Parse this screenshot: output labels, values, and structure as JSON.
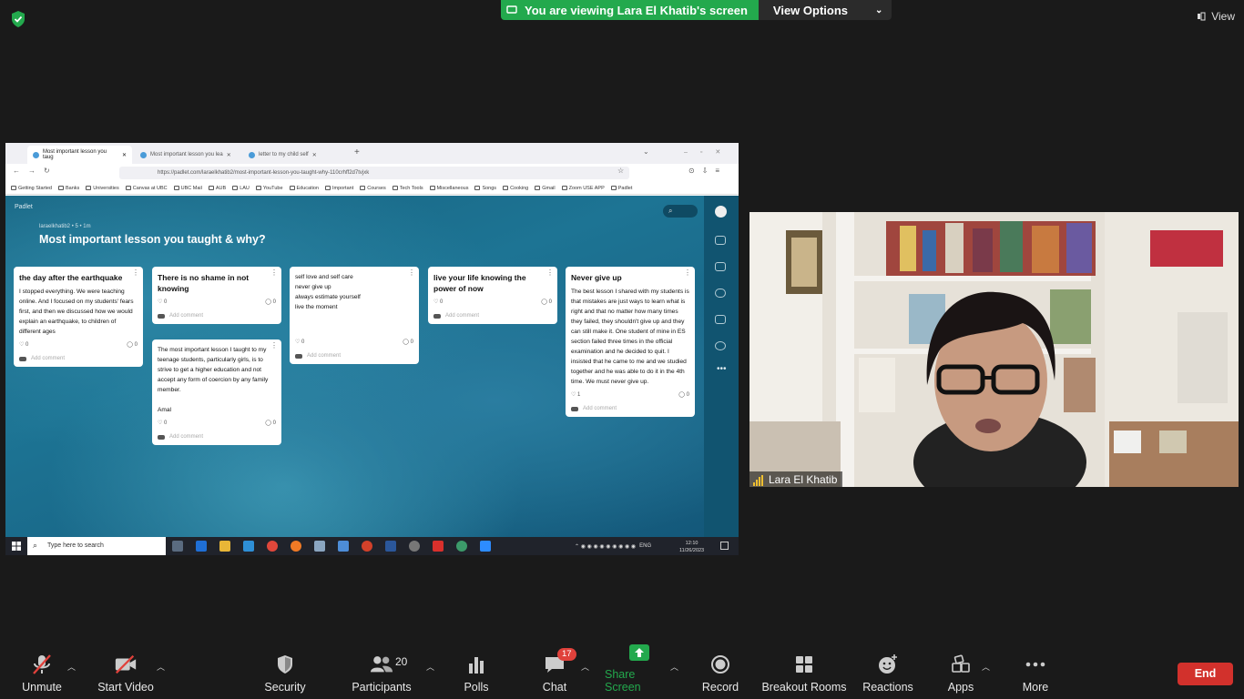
{
  "zoom": {
    "banner_text": "You are viewing Lara El Khatib's screen",
    "view_options": "View Options",
    "view_label": "View",
    "participant_name": "Lara El Khatib",
    "toolbar": {
      "unmute": "Unmute",
      "start_video": "Start Video",
      "security": "Security",
      "participants": "Participants",
      "participants_count": "20",
      "polls": "Polls",
      "chat": "Chat",
      "chat_badge": "17",
      "share_screen": "Share Screen",
      "record": "Record",
      "breakout_rooms": "Breakout Rooms",
      "reactions": "Reactions",
      "apps": "Apps",
      "more": "More",
      "end": "End"
    },
    "colors": {
      "green": "#23a94d",
      "end_red": "#d2312c",
      "badge_red": "#e0413b"
    }
  },
  "browser": {
    "tabs": [
      "Most important lesson you taug",
      "Most important lesson you lea",
      "letter to my child self"
    ],
    "url": "https://padlet.com/laraelkhatib2/most-important-lesson-you-taught-why-110crhff2d7tvjxk",
    "bookmarks": [
      "Getting Started",
      "Banks",
      "Universities",
      "Canvas at UBC",
      "UBC Mail",
      "AUB",
      "LAU",
      "YouTube",
      "Education",
      "Important",
      "Courses",
      "Tech Tools",
      "Miscellaneous",
      "Songs",
      "Cooking",
      "Gmail",
      "Zoom USE APP",
      "Padlet"
    ]
  },
  "padlet": {
    "logo": "Padlet",
    "author": "laraelkhatib2 • 5 • 1m",
    "title": "Most important lesson you taught & why?",
    "add_comment": "Add comment",
    "cards": [
      {
        "title": "the day after the earthquake",
        "body": "I stopped everything. We were teaching online. And I focused on my students' fears first, and then we discussed how we would explain an earthquake, to children of different ages",
        "likes": "0",
        "comments": "0"
      },
      {
        "title": "There is no shame in not knowing",
        "body": "",
        "likes": "0",
        "comments": "0"
      },
      {
        "title": "",
        "body": "The most important lesson I taught to my teenage students, particularly girls, is to strive to get a higher education and not accept any form of coercion by any family member.",
        "signature": "Amal",
        "likes": "0",
        "comments": "0"
      },
      {
        "title": "",
        "lines": [
          "self love and self care",
          "never give up",
          "always estimate yourself",
          "live the moment"
        ],
        "likes": "0",
        "comments": "0"
      },
      {
        "title": "live your life knowing the power of now",
        "body": "",
        "likes": "0",
        "comments": "0"
      },
      {
        "title": "Never give up",
        "body": "The best lesson I shared with my students is that mistakes are just ways to learn what is right and that no matter how many times they failed, they shouldn't give up and they can still make it. One student of mine in ES section failed three times in the official examination and he decided to quit. I insisted that he came to me and we studied together and he was able to do it in the 4th time. We must never give up.",
        "likes": "1",
        "comments": "0"
      }
    ]
  },
  "taskbar": {
    "search_placeholder": "Type here to search",
    "lang": "ENG",
    "time": "12:10",
    "date": "11/26/2023"
  }
}
